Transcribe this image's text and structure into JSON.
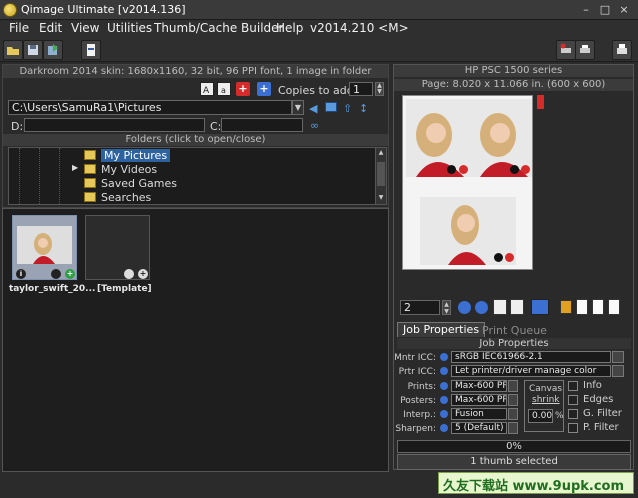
{
  "window": {
    "title": "Qimage Ultimate [v2014.136]",
    "minimize_glyph": "–",
    "restore_glyph": "□",
    "close_glyph": "×"
  },
  "menu": {
    "items": [
      "File",
      "Edit",
      "View",
      "Utilities",
      "Thumb/Cache Builder",
      "Help",
      "v2014.210 <M>"
    ]
  },
  "browser": {
    "status_text": "Darkroom 2014 skin: 1680x1160, 32 bit, 96 PPI font, 1 image in folder",
    "copies_label": "Copies to add:",
    "copies_value": "1",
    "path_value": "C:\\Users\\SamuRa1\\Pictures",
    "drive_d_label": "D:",
    "drive_c_label": "C:",
    "folders_header": "Folders (click to open/close)",
    "folders": [
      {
        "label": "My Pictures",
        "selected": true,
        "expander": ""
      },
      {
        "label": "My Videos",
        "selected": false,
        "expander": "▶"
      },
      {
        "label": "Saved Games",
        "selected": false,
        "expander": ""
      },
      {
        "label": "Searches",
        "selected": false,
        "expander": ""
      }
    ]
  },
  "thumbnails": [
    {
      "caption": "taylor_swift_20...",
      "info_glyph": "i"
    },
    {
      "caption": "[Template]"
    }
  ],
  "printer": {
    "name": "HP PSC 1500 series",
    "page_info": "Page: 8.020 x 11.066 in.  (600 x 600)",
    "page_number": "2"
  },
  "tabs": {
    "job_properties": "Job Properties",
    "print_queue": "Print Queue"
  },
  "job": {
    "header": "Job Properties",
    "mntr_icc_label": "Mntr ICC:",
    "mntr_icc_value": "sRGB IEC61966-2.1",
    "prtr_icc_label": "Prtr ICC:",
    "prtr_icc_value": "Let printer/driver manage color",
    "prints_label": "Prints:",
    "prints_value": "Max-600 PPI",
    "posters_label": "Posters:",
    "posters_value": "Max-600 PPI",
    "interp_label": "Interp.:",
    "interp_value": "Fusion",
    "sharpen_label": "Sharpen:",
    "sharpen_value": "5 (Default)",
    "canvas_label": "Canvas",
    "shrink_label": "shrink",
    "shrink_value": "0.00",
    "percent": "%",
    "checks": [
      "Info",
      "Edges",
      "G. Filter",
      "P. Filter"
    ]
  },
  "progress": {
    "label": "0%",
    "value": 0
  },
  "status": {
    "text": "1 thumb selected"
  },
  "watermark": {
    "text": "久友下载站 www.9upk.com"
  },
  "colors": {
    "accent_blue": "#2d62a0",
    "red_button": "#d62b2b",
    "green_button": "#2ea043"
  }
}
